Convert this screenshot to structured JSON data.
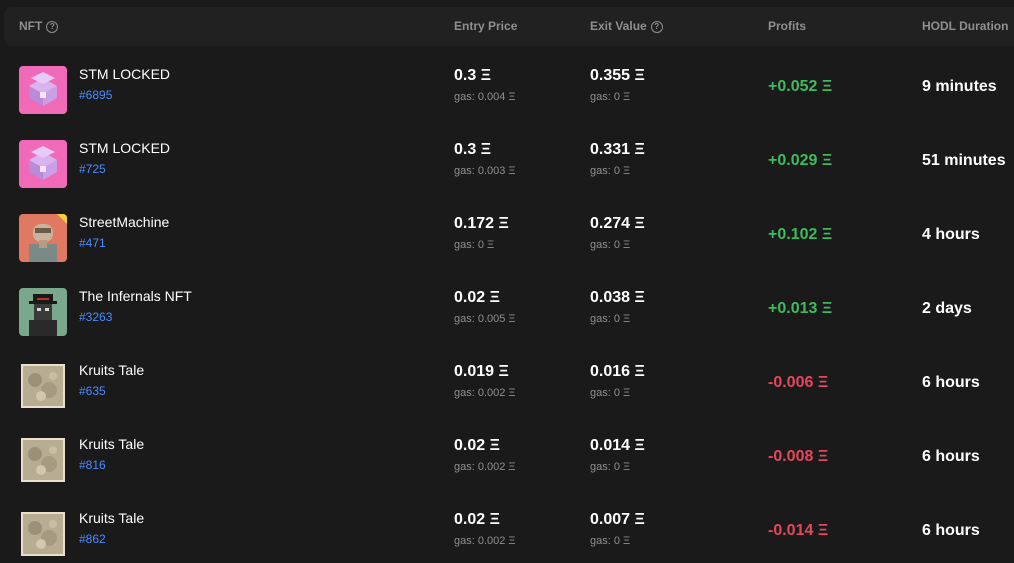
{
  "header": {
    "nft": "NFT",
    "entry_price": "Entry Price",
    "exit_value": "Exit Value",
    "profits": "Profits",
    "hodl_duration": "HODL Duration",
    "help_glyph": "?"
  },
  "colors": {
    "positive": "#3dbb5e",
    "negative": "#e5475c",
    "link": "#4a8cff"
  },
  "rows": [
    {
      "name": "STM LOCKED",
      "id": "#6895",
      "thumb": "stm-locked-chest",
      "entry": "0.3 Ξ",
      "entry_gas": "gas: 0.004 Ξ",
      "exit": "0.355 Ξ",
      "exit_gas": "gas: 0 Ξ",
      "profit": "+0.052 Ξ",
      "profit_sign": "pos",
      "duration": "9 minutes"
    },
    {
      "name": "STM LOCKED",
      "id": "#725",
      "thumb": "stm-locked-chest",
      "entry": "0.3 Ξ",
      "entry_gas": "gas: 0.003 Ξ",
      "exit": "0.331 Ξ",
      "exit_gas": "gas: 0 Ξ",
      "profit": "+0.029 Ξ",
      "profit_sign": "pos",
      "duration": "51 minutes"
    },
    {
      "name": "StreetMachine",
      "id": "#471",
      "thumb": "street-machine-character",
      "entry": "0.172 Ξ",
      "entry_gas": "gas: 0 Ξ",
      "exit": "0.274 Ξ",
      "exit_gas": "gas: 0 Ξ",
      "profit": "+0.102 Ξ",
      "profit_sign": "pos",
      "duration": "4 hours"
    },
    {
      "name": "The Infernals NFT",
      "id": "#3263",
      "thumb": "infernals-pixel-character",
      "entry": "0.02 Ξ",
      "entry_gas": "gas: 0.005 Ξ",
      "exit": "0.038 Ξ",
      "exit_gas": "gas: 0 Ξ",
      "profit": "+0.013 Ξ",
      "profit_sign": "pos",
      "duration": "2 days"
    },
    {
      "name": "Kruits Tale",
      "id": "#635",
      "thumb": "kruits-tale-map",
      "entry": "0.019 Ξ",
      "entry_gas": "gas: 0.002 Ξ",
      "exit": "0.016 Ξ",
      "exit_gas": "gas: 0 Ξ",
      "profit": "-0.006 Ξ",
      "profit_sign": "neg",
      "duration": "6 hours"
    },
    {
      "name": "Kruits Tale",
      "id": "#816",
      "thumb": "kruits-tale-map",
      "entry": "0.02 Ξ",
      "entry_gas": "gas: 0.002 Ξ",
      "exit": "0.014 Ξ",
      "exit_gas": "gas: 0 Ξ",
      "profit": "-0.008 Ξ",
      "profit_sign": "neg",
      "duration": "6 hours"
    },
    {
      "name": "Kruits Tale",
      "id": "#862",
      "thumb": "kruits-tale-map",
      "entry": "0.02 Ξ",
      "entry_gas": "gas: 0.002 Ξ",
      "exit": "0.007 Ξ",
      "exit_gas": "gas: 0 Ξ",
      "profit": "-0.014 Ξ",
      "profit_sign": "neg",
      "duration": "6 hours"
    }
  ]
}
